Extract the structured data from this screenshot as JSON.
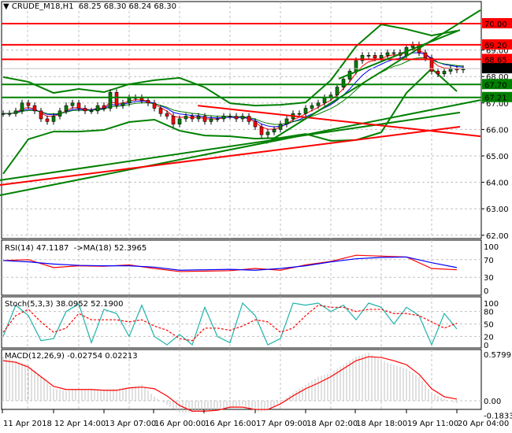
{
  "header": {
    "symbol": "CRUDE_M18,H1",
    "ohlc": "68.25 68.30 68.24 68.30",
    "menu_icon": "triangle-down-icon"
  },
  "chart_data": [
    {
      "type": "candlestick",
      "title": "CRUDE_M18,H1",
      "ylim": [
        62,
        70
      ],
      "yticks": [
        "62.00",
        "63.00",
        "64.00",
        "65.00",
        "66.00",
        "67.00",
        "68.00",
        "69.00"
      ],
      "x_labels": [
        "11 Apr 2018",
        "12 Apr 14:00",
        "13 Apr 07:00",
        "16 Apr 00:00",
        "16 Apr 16:00",
        "17 Apr 09:00",
        "18 Apr 02:00",
        "18 Apr 18:00",
        "19 Apr 11:00",
        "20 Apr 04:00"
      ],
      "grid": true,
      "bull_color": "#008000",
      "bear_color": "#ff0000",
      "closes": [
        66.6,
        66.6,
        66.7,
        67.0,
        66.9,
        66.7,
        66.4,
        66.3,
        66.5,
        66.7,
        66.9,
        67.0,
        66.8,
        66.7,
        66.7,
        66.9,
        66.8,
        67.4,
        66.9,
        67.0,
        67.2,
        67.2,
        67.1,
        67.0,
        66.8,
        66.6,
        66.5,
        66.2,
        66.4,
        66.5,
        66.4,
        66.5,
        66.3,
        66.4,
        66.4,
        66.5,
        66.5,
        66.4,
        66.5,
        66.3,
        66.1,
        65.8,
        65.9,
        66.0,
        66.2,
        66.4,
        66.6,
        66.6,
        66.8,
        66.9,
        67.0,
        67.2,
        67.3,
        67.6,
        67.9,
        68.2,
        68.6,
        68.8,
        68.8,
        68.7,
        68.8,
        68.9,
        68.9,
        68.8,
        69.1,
        69.2,
        68.9,
        68.7,
        68.2,
        68.1,
        68.2,
        68.3,
        68.25,
        68.3
      ],
      "levels": [
        {
          "price": 70.0,
          "label": "70.00",
          "color": "#ff0000"
        },
        {
          "price": 69.2,
          "label": "69.20",
          "color": "#ff0000"
        },
        {
          "price": 68.65,
          "label": "68.65",
          "color": "#ff0000"
        },
        {
          "price": 68.3,
          "label": "68.30",
          "color": "#000000",
          "line": "#c0c0c0"
        },
        {
          "price": 67.7,
          "label": "67.70",
          "color": "#008000"
        },
        {
          "price": 67.21,
          "label": "67.21",
          "color": "#008000"
        }
      ],
      "trendlines": [
        {
          "color": "#008000",
          "from": {
            "bar": -0.5,
            "price": 64.08
          },
          "to": {
            "bar": 72.5,
            "price": 66.64
          }
        },
        {
          "color": "#008000",
          "from": {
            "bar": -0.5,
            "price": 63.51
          },
          "to": {
            "bar": 75.75,
            "price": 67.11
          }
        },
        {
          "color": "#ff0000",
          "from": {
            "bar": -0.5,
            "price": 63.9
          },
          "to": {
            "bar": 72.5,
            "price": 66.1
          }
        },
        {
          "color": "#ff0000",
          "from": {
            "bar": 30.9,
            "price": 66.9
          },
          "to": {
            "bar": 75.75,
            "price": 65.74
          }
        },
        {
          "color": "#008000",
          "from": {
            "bar": 41.75,
            "price": 65.48
          },
          "to": {
            "bar": 75.75,
            "price": 70.51
          }
        },
        {
          "color": "#008000",
          "from": {
            "bar": 53.25,
            "price": 67.92
          },
          "to": {
            "bar": 72.5,
            "price": 69.76
          }
        }
      ],
      "bollinger": {
        "color": "#008000",
        "upper": [
          67.98,
          67.8,
          67.38,
          67.53,
          67.41,
          67.71,
          67.86,
          67.95,
          67.59,
          66.99,
          66.9,
          66.93,
          67.02,
          67.86,
          69.14,
          69.97,
          69.79,
          69.55,
          69.73
        ],
        "lower": [
          64.32,
          65.63,
          65.92,
          65.92,
          65.98,
          66.28,
          66.37,
          65.95,
          65.77,
          65.74,
          65.65,
          65.68,
          65.83,
          65.57,
          65.6,
          65.89,
          67.38,
          68.3,
          67.44
        ]
      },
      "ma_colors": [
        "#ff0000",
        "#0000ff",
        "#008000"
      ]
    },
    {
      "type": "line",
      "title": "RSI(14) 47.1187  ->MA(18) 52.3965",
      "ylim": [
        0,
        100
      ],
      "yticks": [
        "100",
        "70",
        "30",
        "0"
      ],
      "series": [
        {
          "name": "RSI(14)",
          "color": "#ff0000",
          "values": [
            68,
            70,
            52,
            56,
            55,
            58,
            50,
            43,
            44,
            45,
            50,
            46,
            58,
            66,
            80,
            78,
            76,
            50,
            47
          ]
        },
        {
          "name": "MA(18)",
          "color": "#0000ff",
          "values": [
            68,
            65,
            60,
            57,
            56,
            56,
            53,
            46,
            47,
            48,
            46,
            50,
            56,
            65,
            72,
            75,
            76,
            63,
            52
          ]
        }
      ]
    },
    {
      "type": "line",
      "title": "Stoch(5,3,3) 38.0952 52.1900",
      "ylim": [
        0,
        100
      ],
      "yticks": [
        "100",
        "80",
        "50",
        "20",
        "0"
      ],
      "series": [
        {
          "name": "main",
          "color": "#20b2aa",
          "values": [
            20,
            95,
            70,
            10,
            15,
            80,
            98,
            5,
            85,
            75,
            20,
            95,
            20,
            0,
            25,
            0,
            90,
            20,
            5,
            100,
            70,
            0,
            15,
            100,
            95,
            100,
            80,
            95,
            60,
            100,
            90,
            50,
            90,
            70,
            0,
            75,
            38
          ]
        },
        {
          "name": "signal",
          "color": "#ff0000",
          "values": [
            30,
            70,
            85,
            55,
            30,
            40,
            75,
            60,
            60,
            60,
            55,
            60,
            45,
            35,
            15,
            10,
            40,
            40,
            35,
            45,
            60,
            55,
            30,
            40,
            70,
            95,
            90,
            90,
            80,
            85,
            85,
            75,
            75,
            70,
            55,
            40,
            52
          ]
        }
      ]
    },
    {
      "type": "bar",
      "title": "MACD(12,26,9) -0.02754 0.02213",
      "ylim": [
        -0.18339,
        0.5799
      ],
      "yticks": [
        "0.5799",
        "0.00",
        "-0.18339"
      ],
      "histogram": {
        "color": "#c0c0c0",
        "values": [
          0.55,
          0.5,
          0.45,
          0.3,
          0.15,
          0.12,
          0.15,
          0.15,
          0.14,
          0.15,
          0.17,
          0.2,
          0.05,
          -0.05,
          -0.15,
          -0.15,
          -0.12,
          -0.12,
          -0.1,
          -0.05,
          -0.15,
          -0.12,
          -0.02,
          0.1,
          0.2,
          0.3,
          0.35,
          0.45,
          0.55,
          0.6,
          0.5,
          0.45,
          0.4,
          0.3,
          0.1,
          0.02,
          -0.03
        ]
      },
      "signal": {
        "color": "#ff0000",
        "values": [
          0.5,
          0.48,
          0.42,
          0.3,
          0.18,
          0.14,
          0.14,
          0.14,
          0.13,
          0.13,
          0.16,
          0.17,
          0.15,
          0.06,
          -0.06,
          -0.13,
          -0.13,
          -0.12,
          -0.08,
          -0.08,
          -0.11,
          -0.11,
          -0.04,
          0.06,
          0.15,
          0.22,
          0.3,
          0.4,
          0.5,
          0.55,
          0.54,
          0.5,
          0.45,
          0.33,
          0.15,
          0.05,
          0.02
        ]
      }
    }
  ]
}
